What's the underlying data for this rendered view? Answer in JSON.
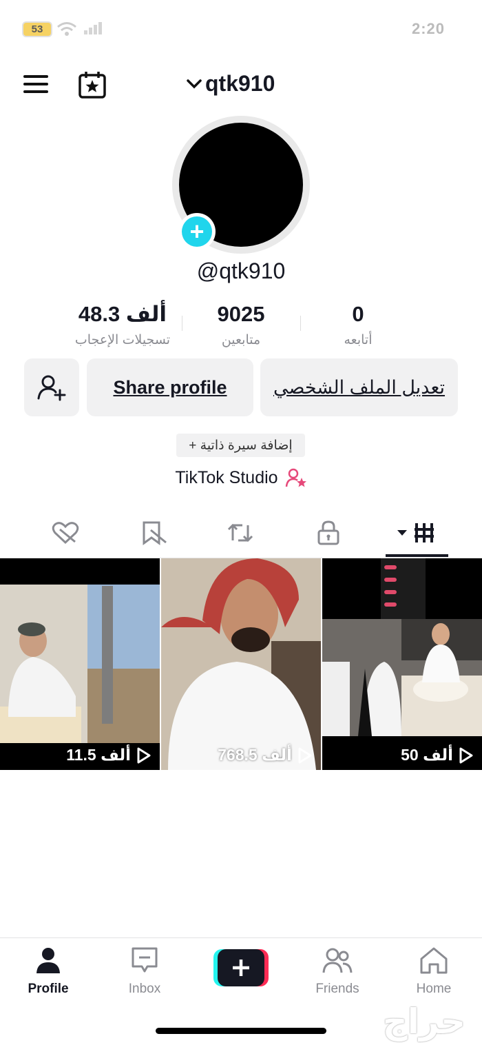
{
  "status_bar": {
    "battery": "53",
    "time": "2:20"
  },
  "header": {
    "username": "qtk910"
  },
  "profile": {
    "handle": "@qtk910",
    "stats": [
      {
        "value": "48.3 ألف",
        "label": "تسجيلات الإعجاب"
      },
      {
        "value": "9025",
        "label": "متابعين"
      },
      {
        "value": "0",
        "label": "أتابعه"
      }
    ],
    "buttons": {
      "share": "Share profile",
      "edit": "تعديل الملف الشخصي"
    },
    "bio_button": "+ إضافة سيرة ذاتية",
    "studio": "TikTok Studio"
  },
  "videos": [
    {
      "views": "11.5 ألف"
    },
    {
      "views": "768.5 ألف"
    },
    {
      "views": "50 ألف"
    }
  ],
  "bottom_nav": {
    "profile": "Profile",
    "inbox": "Inbox",
    "friends": "Friends",
    "home": "Home"
  },
  "watermark": "حراج",
  "colors": {
    "accent_cyan": "#20d5ec",
    "accent_pink": "#fe2c55",
    "studio_icon": "#e6497a"
  }
}
